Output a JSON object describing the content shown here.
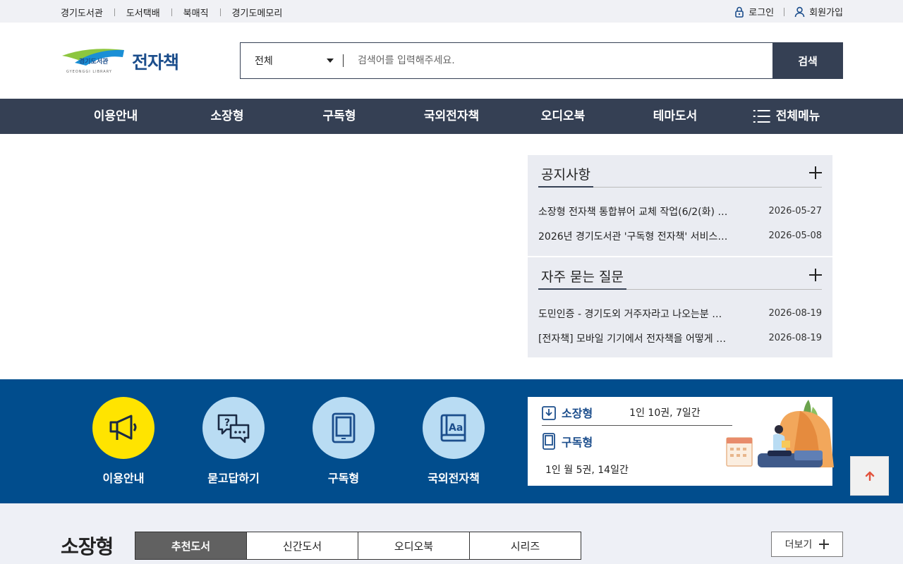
{
  "top_links": [
    "경기도서관",
    "도서택배",
    "북매직",
    "경기도메모리"
  ],
  "user_links": {
    "login": "로그인",
    "join": "회원가입"
  },
  "logo": {
    "library_text": "경기도서관",
    "library_en": "GYEONGGI LIBRARY",
    "title": "전자책"
  },
  "search": {
    "category": "전체",
    "placeholder": "검색어를 입력해주세요.",
    "button": "검색"
  },
  "gnb": [
    "이용안내",
    "소장형",
    "구독형",
    "국외전자책",
    "오디오북",
    "테마도서",
    "전체메뉴"
  ],
  "notice": {
    "title": "공지사항",
    "items": [
      {
        "title": "소장형 전자책 통합뷰어 교체 작업(6/2(화) …",
        "date": "2026-05-27"
      },
      {
        "title": "2026년 경기도서관 '구독형 전자책' 서비스…",
        "date": "2026-05-08"
      }
    ]
  },
  "faq": {
    "title": "자주 묻는 질문",
    "items": [
      {
        "title": "도민인증 - 경기도외 거주자라고 나오는분 …",
        "date": "2026-08-19"
      },
      {
        "title": "[전자책] 모바일 기기에서 전자책을 어떻게 …",
        "date": "2026-08-19"
      }
    ]
  },
  "quick_links": [
    {
      "label": "이용안내",
      "icon": "megaphone-icon"
    },
    {
      "label": "묻고답하기",
      "icon": "chat-question-icon"
    },
    {
      "label": "구독형",
      "icon": "tablet-icon"
    },
    {
      "label": "국외전자책",
      "icon": "book-aa-icon"
    }
  ],
  "info": {
    "owned": {
      "name": "소장형",
      "value": "1인 10권, 7일간"
    },
    "subscribed": {
      "name": "구독형",
      "value": "1인 월 5권, 14일간"
    }
  },
  "section": {
    "title": "소장형",
    "tabs": [
      "추천도서",
      "신간도서",
      "오디오북",
      "시리즈"
    ],
    "active_tab": 0,
    "more": "더보기"
  },
  "colors": {
    "navy": "#354054",
    "blue_band": "#014d8d",
    "accent_yellow": "#ffe400",
    "circle_light": "#b9dcf3"
  }
}
